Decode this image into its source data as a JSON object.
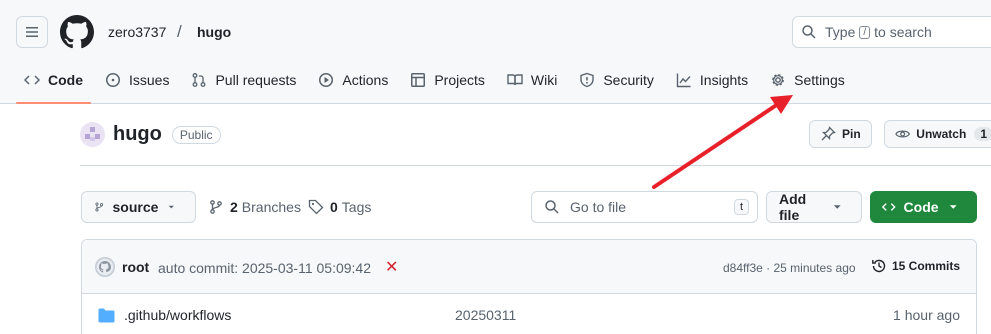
{
  "header": {
    "owner": "zero3737",
    "separator": "/",
    "repo": "hugo",
    "search": {
      "prefix": "Type",
      "key": "/",
      "suffix": "to search"
    }
  },
  "tabs": [
    {
      "label": "Code",
      "icon": "code-icon",
      "active": true
    },
    {
      "label": "Issues",
      "icon": "issue-icon"
    },
    {
      "label": "Pull requests",
      "icon": "pull-request-icon"
    },
    {
      "label": "Actions",
      "icon": "play-icon"
    },
    {
      "label": "Projects",
      "icon": "table-icon"
    },
    {
      "label": "Wiki",
      "icon": "book-icon"
    },
    {
      "label": "Security",
      "icon": "shield-icon"
    },
    {
      "label": "Insights",
      "icon": "graph-icon"
    },
    {
      "label": "Settings",
      "icon": "gear-icon"
    }
  ],
  "repo_header": {
    "name": "hugo",
    "visibility": "Public",
    "pin_label": "Pin",
    "unwatch_label": "Unwatch",
    "watch_count": "1"
  },
  "toolbar": {
    "branch": "source",
    "branches_count": "2",
    "branches_label": "Branches",
    "tags_count": "0",
    "tags_label": "Tags",
    "goto_placeholder": "Go to file",
    "goto_key": "t",
    "add_file_label": "Add file",
    "code_label": "Code"
  },
  "latest_commit": {
    "author": "root",
    "message": "auto commit: 2025-03-11 05:09:42",
    "status": "✕",
    "hash_time": "d84ff3e · 25 minutes ago",
    "commits_label": "15 Commits"
  },
  "files": [
    {
      "name": ".github/workflows",
      "commit": "20250311",
      "age": "1 hour ago",
      "type": "folder"
    }
  ],
  "colors": {
    "accent_green": "#1f883d",
    "tab_underline": "#fd8c73",
    "fail_red": "#d1242f",
    "arrow_red": "#e8202a"
  }
}
